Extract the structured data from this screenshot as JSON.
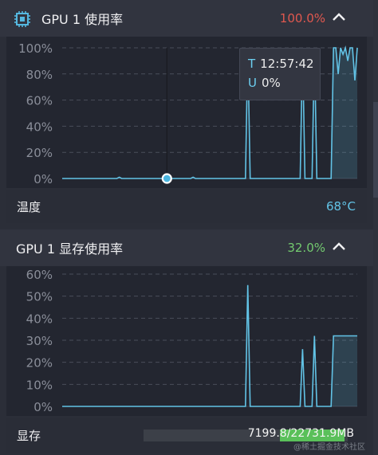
{
  "gpu_util": {
    "title": "GPU 1 使用率",
    "value": "100.0%",
    "value_color": "#e0584f",
    "icon": "gpu-chip-icon",
    "expand_icon": "chevron-up-icon",
    "tooltip": {
      "time_key": "T",
      "time": "12:57:42",
      "util_key": "U",
      "util": "0%"
    }
  },
  "temperature": {
    "label": "温度",
    "value": "68°C"
  },
  "gpu_mem": {
    "title": "GPU 1 显存使用率",
    "value": "32.0%",
    "value_color": "#73c96f",
    "expand_icon": "chevron-up-icon"
  },
  "memory": {
    "label": "显存",
    "used_mb": 7199.8,
    "total_mb": 22731.9,
    "fill_fraction": 0.317,
    "text": "7199.8/22731.9MB",
    "fill_color": "#5ac05a"
  },
  "watermark": "@稀土掘金技术社区",
  "chart_data": [
    {
      "type": "line",
      "title": "GPU 1 使用率",
      "ylabel": "",
      "xlabel": "",
      "y_ticks": [
        "0%",
        "20%",
        "40%",
        "60%",
        "80%",
        "100%"
      ],
      "ylim": [
        0,
        100
      ],
      "grid": true,
      "series": [
        {
          "color": "#62c3e6",
          "values": [
            0,
            0,
            0,
            0,
            0,
            0,
            0,
            0,
            0,
            0,
            0,
            0,
            0,
            0,
            0,
            0,
            0,
            0,
            0,
            0,
            0,
            0,
            0,
            0,
            1,
            0,
            0,
            0,
            0,
            0,
            0,
            0,
            0,
            0,
            0,
            0,
            0,
            0,
            0,
            0,
            0,
            0,
            0,
            0,
            0,
            0,
            0,
            0,
            0,
            0,
            0,
            0,
            0,
            0,
            0,
            1,
            0,
            0,
            0,
            0,
            0,
            0,
            0,
            0,
            0,
            0,
            0,
            0,
            0,
            0,
            0,
            0,
            0,
            0,
            0,
            0,
            0,
            0,
            100,
            0,
            0,
            0,
            0,
            0,
            0,
            0,
            0,
            0,
            0,
            0,
            0,
            0,
            0,
            0,
            0,
            0,
            0,
            0,
            0,
            0,
            0,
            100,
            0,
            0,
            0,
            0,
            100,
            0,
            0,
            0,
            0,
            0,
            0,
            0,
            100,
            100,
            80,
            100,
            95,
            100,
            90,
            100,
            100,
            75,
            100
          ]
        }
      ]
    },
    {
      "type": "line",
      "title": "GPU 1 显存使用率",
      "ylabel": "",
      "xlabel": "",
      "y_ticks": [
        "0%",
        "10%",
        "20%",
        "30%",
        "40%",
        "50%",
        "60%"
      ],
      "ylim": [
        0,
        60
      ],
      "grid": true,
      "series": [
        {
          "color": "#62c3e6",
          "values": [
            0,
            0,
            0,
            0,
            0,
            0,
            0,
            0,
            0,
            0,
            0,
            0,
            0,
            0,
            0,
            0,
            0,
            0,
            0,
            0,
            0,
            0,
            0,
            0,
            0,
            0,
            0,
            0,
            0,
            0,
            0,
            0,
            0,
            0,
            0,
            0,
            0,
            0,
            0,
            0,
            0,
            0,
            0,
            0,
            0,
            0,
            0,
            0,
            0,
            0,
            0,
            0,
            0,
            0,
            0,
            0,
            0,
            0,
            0,
            0,
            0,
            0,
            0,
            0,
            0,
            0,
            0,
            0,
            0,
            0,
            0,
            0,
            0,
            0,
            0,
            0,
            0,
            0,
            55,
            0,
            0,
            0,
            0,
            0,
            0,
            0,
            0,
            0,
            0,
            0,
            0,
            0,
            0,
            0,
            0,
            0,
            0,
            0,
            0,
            0,
            0,
            26,
            0,
            0,
            0,
            0,
            32,
            0,
            0,
            0,
            0,
            0,
            0,
            0,
            32,
            32,
            32,
            32,
            32,
            32,
            32,
            32,
            32,
            32,
            32
          ]
        }
      ]
    }
  ]
}
